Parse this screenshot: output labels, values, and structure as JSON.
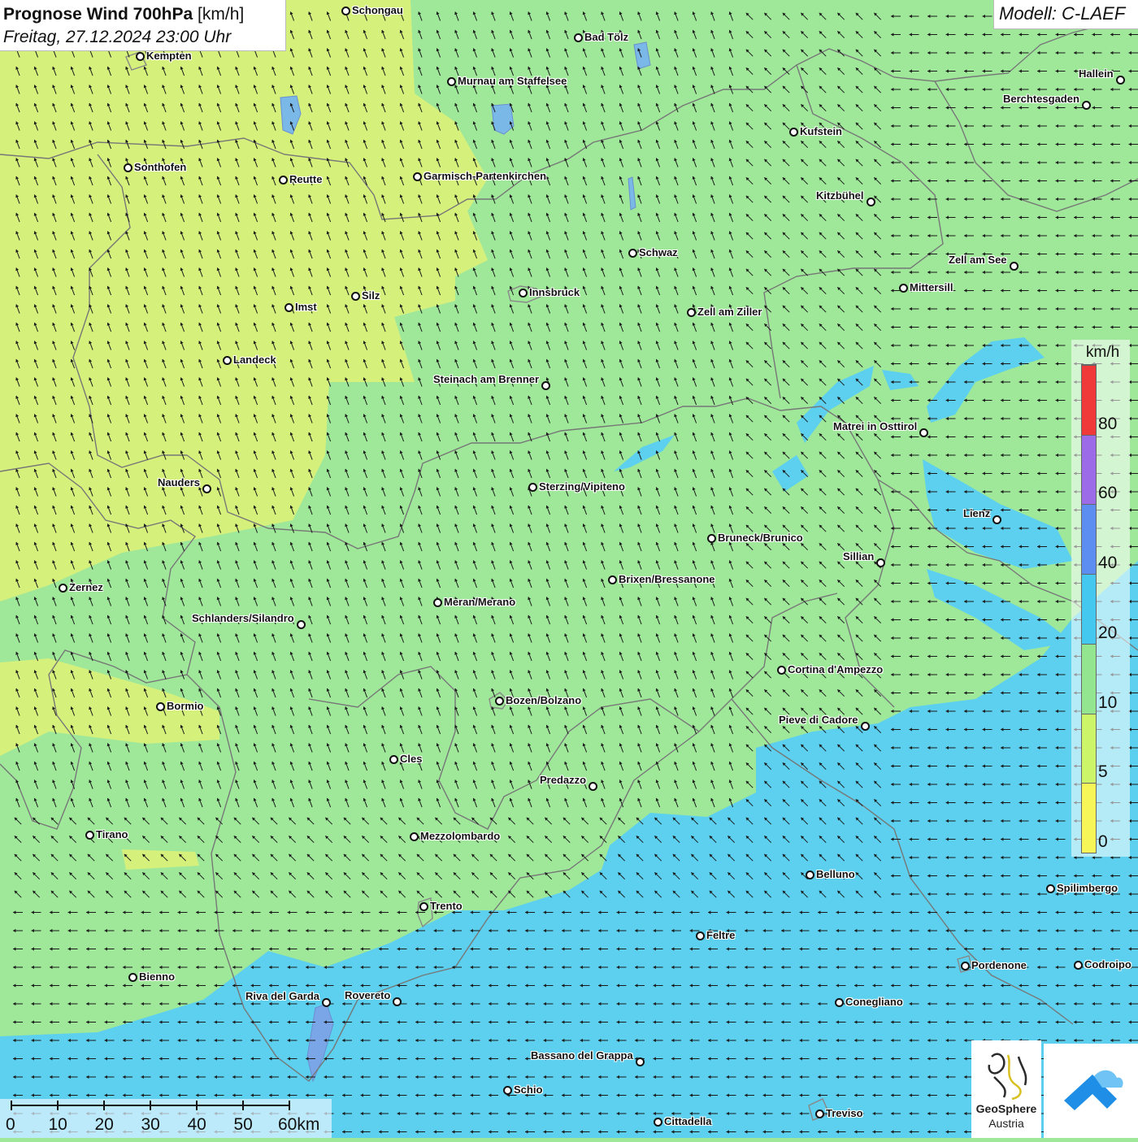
{
  "title": {
    "main": "Prognose Wind 700hPa",
    "unit": "[km/h]",
    "datetime": "Freitag, 27.12.2024 23:00 Uhr"
  },
  "model": "Modell: C-LAEF",
  "legend": {
    "unit": "km/h",
    "classes": [
      {
        "label": "0",
        "color": "#f6f658"
      },
      {
        "label": "5",
        "color": "#cdf56a"
      },
      {
        "label": "10",
        "color": "#93e58f"
      },
      {
        "label": "20",
        "color": "#44c8f0"
      },
      {
        "label": "40",
        "color": "#5b8ef0"
      },
      {
        "label": "60",
        "color": "#9b6be8"
      },
      {
        "label": "80",
        "color": "#f03a3a"
      }
    ]
  },
  "scale_bar": {
    "labels": [
      "0",
      "10",
      "20",
      "30",
      "40",
      "50",
      "60km"
    ]
  },
  "logo": {
    "name_line1": "GeoSphere",
    "name_line2": "Austria"
  },
  "cities": [
    {
      "name": "Schongau",
      "id": "schongau"
    },
    {
      "name": "Kempten",
      "id": "kempten"
    },
    {
      "name": "Bad Tölz",
      "id": "bad-toelz"
    },
    {
      "name": "Murnau am Staffelsee",
      "id": "murnau"
    },
    {
      "name": "Hallein",
      "id": "hallein"
    },
    {
      "name": "Berchtesgaden",
      "id": "berchtesgaden"
    },
    {
      "name": "Kufstein",
      "id": "kufstein"
    },
    {
      "name": "Sonthofen",
      "id": "sonthofen"
    },
    {
      "name": "Reutte",
      "id": "reutte"
    },
    {
      "name": "Garmisch-Partenkirchen",
      "id": "garmisch"
    },
    {
      "name": "Kitzbühel",
      "id": "kitzbuehel"
    },
    {
      "name": "Schwaz",
      "id": "schwaz"
    },
    {
      "name": "Zell am See",
      "id": "zell-am-see"
    },
    {
      "name": "Mittersill",
      "id": "mittersill"
    },
    {
      "name": "Innsbruck",
      "id": "innsbruck"
    },
    {
      "name": "Silz",
      "id": "silz"
    },
    {
      "name": "Imst",
      "id": "imst"
    },
    {
      "name": "Zell am Ziller",
      "id": "zell-am-ziller"
    },
    {
      "name": "Landeck",
      "id": "landeck"
    },
    {
      "name": "Steinach am Brenner",
      "id": "steinach"
    },
    {
      "name": "Matrei in Osttirol",
      "id": "matrei"
    },
    {
      "name": "Nauders",
      "id": "nauders"
    },
    {
      "name": "Sterzing/Vipiteno",
      "id": "sterzing"
    },
    {
      "name": "Lienz",
      "id": "lienz"
    },
    {
      "name": "Bruneck/Brunico",
      "id": "bruneck"
    },
    {
      "name": "Sillian",
      "id": "sillian"
    },
    {
      "name": "Zernez",
      "id": "zernez"
    },
    {
      "name": "Brixen/Bressanone",
      "id": "brixen"
    },
    {
      "name": "Meran/Merano",
      "id": "meran"
    },
    {
      "name": "Schlanders/Silandro",
      "id": "schlanders"
    },
    {
      "name": "Cortina d'Ampezzo",
      "id": "cortina"
    },
    {
      "name": "Bozen/Bolzano",
      "id": "bozen"
    },
    {
      "name": "Bormio",
      "id": "bormio"
    },
    {
      "name": "Pieve di Cadore",
      "id": "pieve-di-cadore"
    },
    {
      "name": "Cles",
      "id": "cles"
    },
    {
      "name": "Predazzo",
      "id": "predazzo"
    },
    {
      "name": "Tirano",
      "id": "tirano"
    },
    {
      "name": "Mezzolombardo",
      "id": "mezzolombardo"
    },
    {
      "name": "Belluno",
      "id": "belluno"
    },
    {
      "name": "Spilimbergo",
      "id": "spilimbergo"
    },
    {
      "name": "Trento",
      "id": "trento"
    },
    {
      "name": "Feltre",
      "id": "feltre"
    },
    {
      "name": "Pordenone",
      "id": "pordenone"
    },
    {
      "name": "Codroipo",
      "id": "codroipo"
    },
    {
      "name": "Bienno",
      "id": "bienno"
    },
    {
      "name": "Riva del Garda",
      "id": "riva"
    },
    {
      "name": "Rovereto",
      "id": "rovereto"
    },
    {
      "name": "Conegliano",
      "id": "conegliano"
    },
    {
      "name": "Bassano del Grappa",
      "id": "bassano"
    },
    {
      "name": "Schio",
      "id": "schio"
    },
    {
      "name": "Treviso",
      "id": "treviso"
    },
    {
      "name": "Cittadella",
      "id": "cittadella"
    }
  ]
}
